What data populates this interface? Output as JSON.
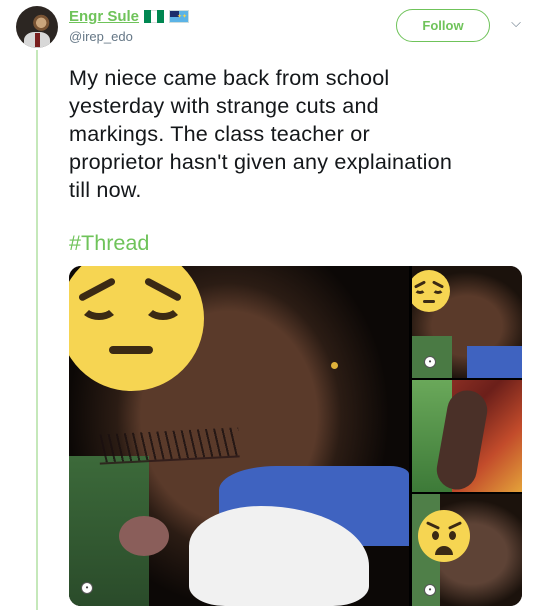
{
  "user": {
    "display_name": "Engr Sule",
    "handle": "@irep_edo",
    "flags": [
      "nigeria-flag-icon",
      "tuvalu-flag-icon"
    ]
  },
  "actions": {
    "follow_label": "Follow",
    "more_icon": "chevron-down-icon"
  },
  "tweet": {
    "text": "My niece came back from school\nyesterday with strange cuts and\nmarkings.  The class teacher or\nproprietor hasn't given any explaination\ntill now.",
    "hashtag": "#Thread"
  },
  "media": {
    "photos": [
      {
        "overlay_icon": "pensive-face-emoji-icon",
        "badge_icon": "gif-dot-icon"
      },
      {
        "overlay_icon": "pensive-face-emoji-icon",
        "badge_icon": "gif-dot-icon"
      },
      {
        "overlay_icon": "none"
      },
      {
        "overlay_icon": "worried-face-emoji-icon",
        "badge_icon": "gif-dot-icon"
      }
    ]
  },
  "colors": {
    "accent": "#6fc35a",
    "thread_line": "#c5e8ba",
    "text": "#14171a",
    "secondary": "#657786"
  }
}
